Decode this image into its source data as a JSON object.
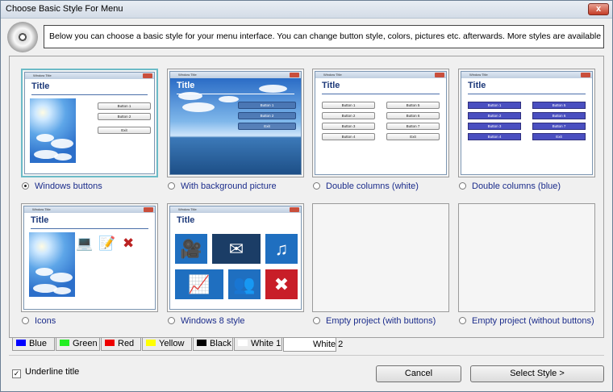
{
  "window": {
    "title": "Choose Basic Style For Menu",
    "close_label": "x"
  },
  "info_text": "Below you can choose a basic style for your menu interface. You can change button style, colors, pictures etc. afterwards. More styles are available in the editor.",
  "preview": {
    "window_title": "Window Title",
    "title": "Title",
    "buttons_single": [
      "Button 1",
      "Button 2",
      "Exit"
    ],
    "buttons_left": [
      "Button 1",
      "Button 2",
      "Button 3",
      "Button 4"
    ],
    "buttons_right": [
      "Button 5",
      "Button 6",
      "Button 7",
      "Exit"
    ]
  },
  "styles": [
    {
      "label": "Windows buttons",
      "selected": true
    },
    {
      "label": "With background picture",
      "selected": false
    },
    {
      "label": "Double columns (white)",
      "selected": false
    },
    {
      "label": "Double columns (blue)",
      "selected": false
    },
    {
      "label": "Icons",
      "selected": false
    },
    {
      "label": "Windows 8 style",
      "selected": false
    },
    {
      "label": "Empty project (with buttons)",
      "selected": false
    },
    {
      "label": "Empty project (without buttons)",
      "selected": false
    }
  ],
  "color_tabs": [
    {
      "label": "Blue",
      "color": "#0000ff"
    },
    {
      "label": "Green",
      "color": "#22ee22"
    },
    {
      "label": "Red",
      "color": "#ee0000"
    },
    {
      "label": "Yellow",
      "color": "#ffff00"
    },
    {
      "label": "Black",
      "color": "#000000"
    },
    {
      "label": "White 1",
      "color": "#ffffff"
    },
    {
      "label": "White 2",
      "color": "#ffffff",
      "active": true
    }
  ],
  "underline_title": {
    "label": "Underline title",
    "checked": true,
    "mark": "✓"
  },
  "buttons": {
    "cancel": "Cancel",
    "next": "Select Style >"
  },
  "tile_colors": [
    "#1f6fc0",
    "#1f6fc0",
    "#1f6fc0",
    "#1f6fc0",
    "#1f6fc0",
    "#c81e28"
  ],
  "tile_icons": [
    "camera-icon",
    "email-icon",
    "music-icon",
    "chart-icon",
    "people-icon",
    "close-icon"
  ],
  "tile_glyphs": [
    "🎥",
    "✉",
    "♫",
    "📈",
    "👥",
    "✖"
  ]
}
